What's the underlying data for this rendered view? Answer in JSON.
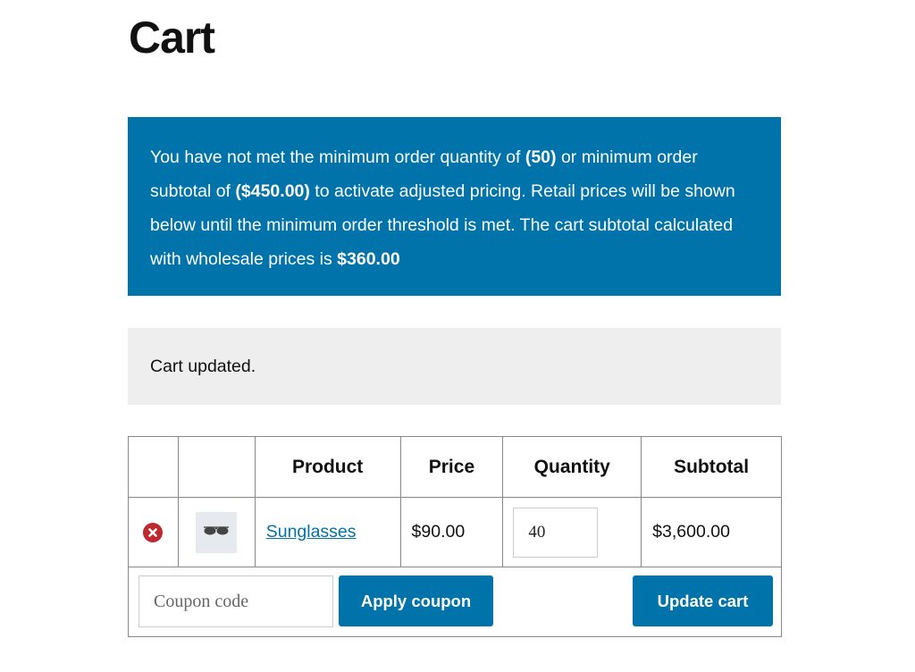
{
  "page": {
    "title": "Cart"
  },
  "notice": {
    "part1": "You have not met the minimum order quantity of ",
    "min_qty": "(50)",
    "part2": " or minimum order subtotal of ",
    "min_subtotal": "($450.00)",
    "part3": " to activate adjusted pricing. Retail prices will be shown below until the minimum order threshold is met. The cart subtotal calculated with wholesale prices is ",
    "wholesale_subtotal": "$360.00",
    "bg_color": "#0073aa"
  },
  "message": {
    "text": "Cart updated."
  },
  "table": {
    "headers": {
      "remove": "",
      "thumbnail": "",
      "product": "Product",
      "price": "Price",
      "quantity": "Quantity",
      "subtotal": "Subtotal"
    },
    "rows": [
      {
        "product": "Sunglasses",
        "price": "$90.00",
        "quantity": "40",
        "subtotal": "$3,600.00",
        "remove_icon": "remove-circle-x-icon",
        "thumbnail_icon": "sunglasses-icon"
      }
    ]
  },
  "actions": {
    "coupon_placeholder": "Coupon code",
    "coupon_value": "",
    "apply_label": "Apply coupon",
    "update_label": "Update cart",
    "accent_color": "#0073aa"
  }
}
